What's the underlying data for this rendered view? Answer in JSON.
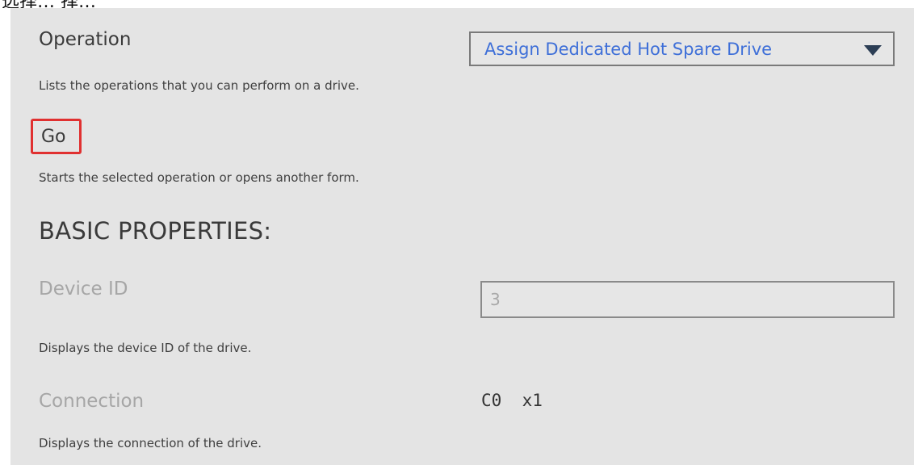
{
  "top_fragment": "选择…  择…",
  "operation": {
    "label": "Operation",
    "help": "Lists the operations that you can perform on a drive.",
    "selected": "Assign Dedicated Hot Spare Drive"
  },
  "go": {
    "label": "Go",
    "help": "Starts the selected operation or opens another form."
  },
  "basic_properties": {
    "heading": "BASIC PROPERTIES:",
    "device_id": {
      "label": "Device ID",
      "value": "3",
      "help": "Displays the device ID of the drive."
    },
    "connection": {
      "label": "Connection",
      "value": "C0  x1",
      "help": "Displays the connection of the drive."
    }
  },
  "colors": {
    "panel_bg": "#e4e4e4",
    "select_text": "#3e6fd8",
    "highlight_box": "#e03030",
    "arrow": "#2c3e55"
  }
}
